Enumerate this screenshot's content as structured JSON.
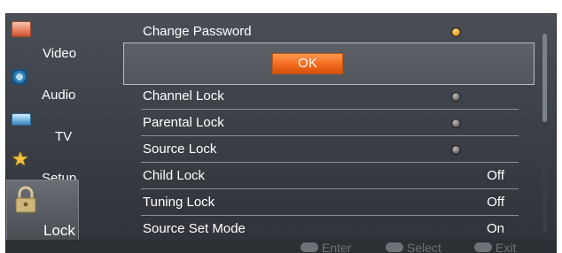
{
  "sidebar": {
    "items": [
      {
        "label": "Video",
        "icon": "video-icon"
      },
      {
        "label": "Audio",
        "icon": "audio-icon"
      },
      {
        "label": "TV",
        "icon": "tv-icon"
      },
      {
        "label": "Setup",
        "icon": "star-icon"
      },
      {
        "label": "Lock",
        "icon": "padlock-icon",
        "active": true
      }
    ]
  },
  "menu": {
    "change_password": "Change Password",
    "dialog": {
      "ok_label": "OK"
    },
    "rows": [
      {
        "label": "Channel Lock",
        "value": ""
      },
      {
        "label": "Parental Lock",
        "value": ""
      },
      {
        "label": "Source Lock",
        "value": ""
      },
      {
        "label": "Child Lock",
        "value": "Off"
      },
      {
        "label": "Tuning Lock",
        "value": "Off"
      },
      {
        "label": "Source Set Mode",
        "value": "On"
      }
    ]
  },
  "footer": {
    "enter": "Enter",
    "select": "Select",
    "exit": "Exit"
  },
  "colors": {
    "accent": "#f36a1e",
    "background": "#3c4047",
    "text": "#ffffff"
  }
}
